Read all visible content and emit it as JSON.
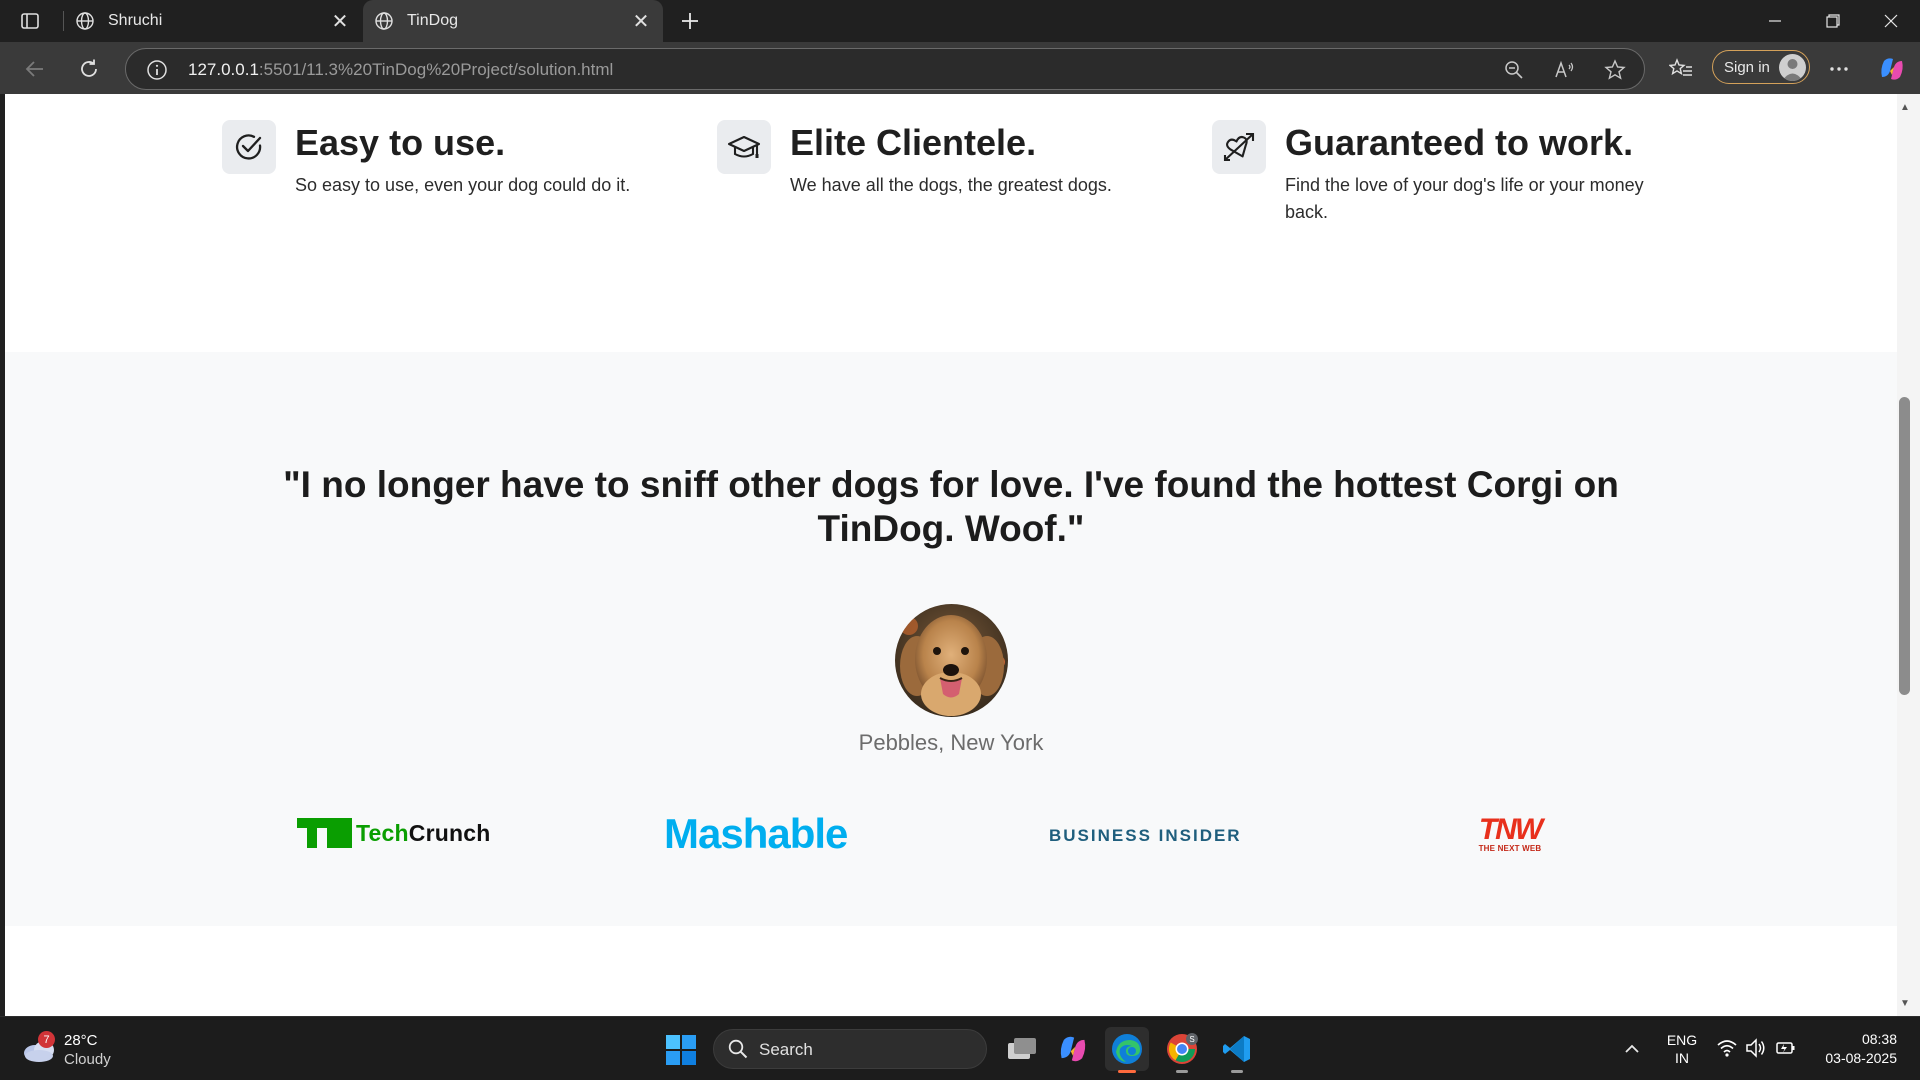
{
  "browser": {
    "tabs": [
      {
        "title": "Shruchi",
        "active": false
      },
      {
        "title": "TinDog",
        "active": true
      }
    ],
    "address": {
      "host": "127.0.0.1",
      "path": ":5501/11.3%20TinDog%20Project/solution.html"
    },
    "signin_label": "Sign in"
  },
  "features": [
    {
      "icon": "check-circle-icon",
      "title": "Easy to use.",
      "text": "So easy to use, even your dog could do it."
    },
    {
      "icon": "graduation-cap-icon",
      "title": "Elite Clientele.",
      "text": "We have all the dogs, the greatest dogs."
    },
    {
      "icon": "heart-arrow-icon",
      "title": "Guaranteed to work.",
      "text": "Find the love of your dog's life or your money back."
    }
  ],
  "testimonial": {
    "quote": "\"I no longer have to sniff other dogs for love. I've found the hottest Corgi on TinDog. Woof.\"",
    "person": "Pebbles, New York"
  },
  "press_logos": {
    "techcrunch_tech": "Tech",
    "techcrunch_crunch": "Crunch",
    "mashable": "Mashable",
    "business_insider": "BUSINESS INSIDER",
    "tnw": "TNW",
    "tnw_sub": "THE NEXT WEB"
  },
  "taskbar": {
    "weather_temp": "28°C",
    "weather_cond": "Cloudy",
    "weather_badge": "7",
    "search_label": "Search",
    "lang_1": "ENG",
    "lang_2": "IN",
    "time": "08:38",
    "date": "03-08-2025"
  },
  "colors": {
    "techcrunch_green": "#0a9e01",
    "mashable_blue": "#00aeef",
    "business_insider": "#1f5e7d",
    "tnw_red": "#e8301c",
    "section_bg": "#f8f9fa"
  }
}
